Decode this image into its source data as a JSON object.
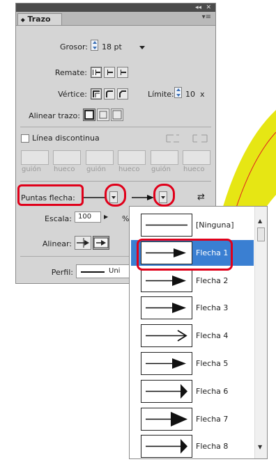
{
  "panel": {
    "collapse_glyph": "◂◂",
    "close_glyph": "✕",
    "tab_label": "Trazo",
    "tab_glyph": "⬥",
    "menu_glyph": "▾≡",
    "grosor_label": "Grosor:",
    "grosor_value": "18 pt",
    "remate_label": "Remate:",
    "vertice_label": "Vértice:",
    "limite_label": "Límite:",
    "limite_value": "10",
    "limite_unit": "x",
    "alinear_trazo_label": "Alinear trazo:",
    "linea_discontinua_label": "Línea discontinua",
    "dash_labels": [
      "guión",
      "hueco",
      "guión",
      "hueco",
      "guión",
      "hueco"
    ],
    "puntas_flecha_label": "Puntas flecha:",
    "swap_glyph": "⇄",
    "escala_label": "Escala:",
    "escala_value": "100",
    "escala_unit": "%",
    "alinear_label": "Alinear:",
    "perfil_label": "Perfil:",
    "perfil_value": "Uni"
  },
  "arrow_list": {
    "items": [
      {
        "label": "[Ninguna]",
        "style": "none",
        "selected": false
      },
      {
        "label": "Flecha 1",
        "style": "thin-triangle",
        "selected": true
      },
      {
        "label": "Flecha 2",
        "style": "triangle",
        "selected": false
      },
      {
        "label": "Flecha 3",
        "style": "triangle",
        "selected": false
      },
      {
        "label": "Flecha 4",
        "style": "open",
        "selected": false
      },
      {
        "label": "Flecha 5",
        "style": "triangle",
        "selected": false
      },
      {
        "label": "Flecha 6",
        "style": "bar-triangle",
        "selected": false
      },
      {
        "label": "Flecha 7",
        "style": "big-triangle",
        "selected": false
      },
      {
        "label": "Flecha 8",
        "style": "bar-triangle",
        "selected": false
      }
    ]
  },
  "colors": {
    "highlight_red": "#e0001a",
    "selection_blue": "#3a7fd2",
    "arc_yellow": "#e6e614"
  }
}
